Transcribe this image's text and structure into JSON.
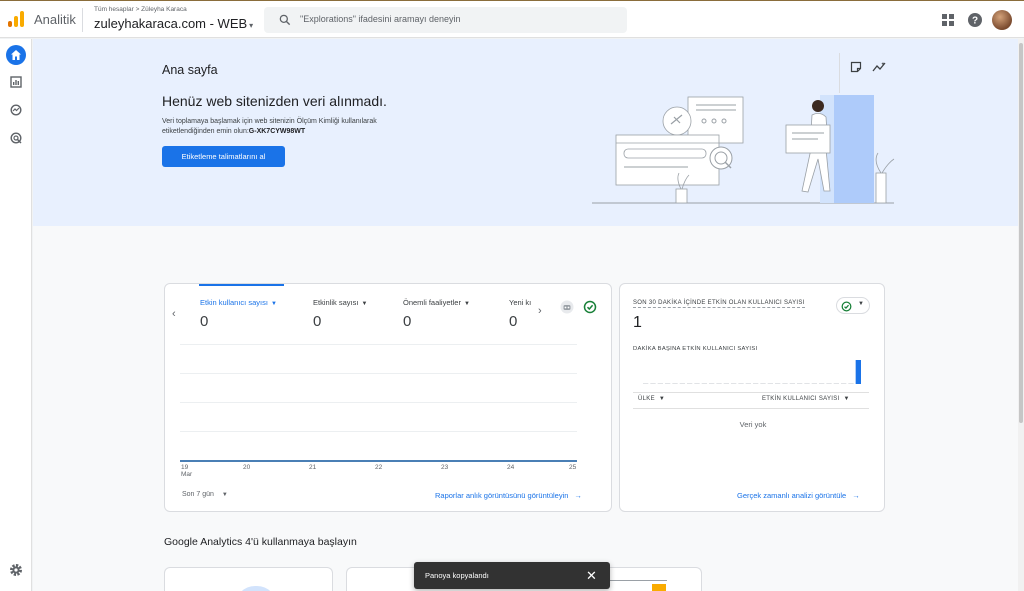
{
  "app": {
    "name": "Analitik"
  },
  "header": {
    "breadcrumb_all": "Tüm hesaplar",
    "breadcrumb_sep": ">",
    "breadcrumb_account": "Züleyha Karaca",
    "property_name": "zuleyhakaraca.com - WEB",
    "property_caret": "▾",
    "search_placeholder": "\"Explorations\" ifadesini aramayı deneyin"
  },
  "hero": {
    "page_title": "Ana sayfa",
    "heading": "Henüz web sitenizden veri alınmadı.",
    "body": "Veri toplamaya başlamak için web sitenizin Ölçüm Kimliği kullanılarak etiketlendiğinden emin olun:",
    "measurement_id": "G-XK7CYW98WT",
    "cta_label": "Etiketleme talimatlarını al"
  },
  "metrics_card": {
    "tabs": [
      {
        "label": "Etkin kullanıcı sayısı",
        "value": "0",
        "active": true
      },
      {
        "label": "Etkinlik sayısı",
        "value": "0",
        "active": false
      },
      {
        "label": "Önemli faaliyetler",
        "value": "0",
        "active": false
      },
      {
        "label": "Yeni kı",
        "value": "0",
        "active": false
      }
    ],
    "x_ticks": [
      "19",
      "20",
      "21",
      "22",
      "23",
      "24",
      "25"
    ],
    "x_month": "Mar",
    "period_label": "Son 7 gün",
    "footer_link": "Raporlar anlık görüntüsünü görüntüleyin"
  },
  "realtime_card": {
    "title": "SON 30 DAKİKA İÇİNDE ETKİN OLAN KULLANICI SAYISI",
    "value": "1",
    "subtitle": "DAKİKA BAŞINA ETKİN KULLANICI SAYISI",
    "minute_bars": [
      0,
      0,
      0,
      0,
      0,
      0,
      0,
      0,
      0,
      0,
      0,
      0,
      0,
      0,
      0,
      0,
      0,
      0,
      0,
      0,
      0,
      0,
      0,
      0,
      0,
      0,
      0,
      0,
      0,
      1
    ],
    "col_country": "ÜLKE",
    "col_users": "ETKİN KULLANICI SAYISI",
    "empty_text": "Veri yok",
    "footer_link": "Gerçek zamanlı analizi görüntüle"
  },
  "section": {
    "title": "Google Analytics 4'ü kullanmaya başlayın"
  },
  "toast": {
    "message": "Panoya kopyalandı",
    "close": "✕"
  },
  "colors": {
    "accent": "#1a73e8",
    "hero_bg": "#e8f0fe",
    "success": "#188038"
  }
}
